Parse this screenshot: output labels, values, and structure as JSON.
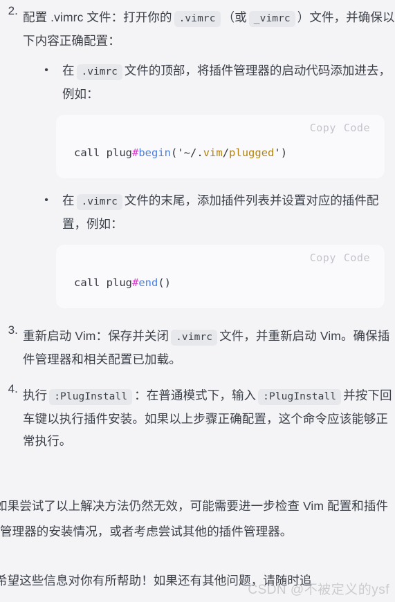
{
  "page": {
    "background_color": "#f4f4f6",
    "text_color": "#3c4048"
  },
  "steps": [
    {
      "marker": "2.",
      "text_before": "配置 .vimrc 文件：打开你的",
      "code_1": ".vimrc",
      "text_mid": "（或",
      "code_2": "_vimrc",
      "text_after": "）文件，并确保以下内容正确配置："
    },
    {
      "marker": "3.",
      "text_before": "重新启动 Vim：保存并关闭",
      "code_1": ".vimrc",
      "text_after": "文件，并重新启动 Vim。确保插件管理器和相关配置已加载。"
    },
    {
      "marker": "4.",
      "text_before": "执行",
      "code_1": ":PlugInstall",
      "text_mid": "：在普通模式下，输入",
      "code_2": ":PlugInstall",
      "text_after": "并按下回车键以执行插件安装。如果以上步骤正确配置，这个命令应该能够正常执行。"
    }
  ],
  "sub_items": [
    {
      "bullet": "•",
      "text_before": "在",
      "code": ".vimrc",
      "text_after": "文件的顶部，将插件管理器的启动代码添加进去，例如："
    },
    {
      "bullet": "•",
      "text_before": "在",
      "code": ".vimrc",
      "text_after": "文件的末尾，添加插件列表并设置对应的插件配置，例如："
    }
  ],
  "code_blocks": [
    {
      "copy_label": "Copy",
      "code_label": "Code",
      "full_code": "call plug#begin('~/.vim/plugged')",
      "tokens": [
        {
          "text": "call plug",
          "class": "tok-plain"
        },
        {
          "text": "#",
          "class": "tok-hash"
        },
        {
          "text": "begin",
          "class": "tok-fn"
        },
        {
          "text": "('~/.",
          "class": "tok-punct"
        },
        {
          "text": "vim",
          "class": "tok-str"
        },
        {
          "text": "/",
          "class": "tok-punct"
        },
        {
          "text": "plugged",
          "class": "tok-str"
        },
        {
          "text": "')",
          "class": "tok-punct"
        }
      ]
    },
    {
      "copy_label": "Copy",
      "code_label": "Code",
      "full_code": "call plug#end()",
      "tokens": [
        {
          "text": "call plug",
          "class": "tok-plain"
        },
        {
          "text": "#",
          "class": "tok-hash"
        },
        {
          "text": "end",
          "class": "tok-fn"
        },
        {
          "text": "()",
          "class": "tok-punct"
        }
      ]
    }
  ],
  "paragraphs": {
    "closing_1": "如果尝试了以上解决方法仍然无效，可能需要进一步检查 Vim 配置和插件管理器的安装情况，或者考虑尝试其他的插件管理器。",
    "closing_2": "希望这些信息对你有所帮助！如果还有其他问题，请随时追"
  },
  "watermark": {
    "text": "CSDN @不被定义的ysf"
  },
  "syntax_colors": {
    "plain": "#32363d",
    "hash": "#d63ac7",
    "function": "#4b7fe0",
    "string": "#b5820d",
    "toolbar": "#c3c4ca",
    "code_bg": "#fafafc",
    "inline_code_bg": "#e7e8ec"
  }
}
